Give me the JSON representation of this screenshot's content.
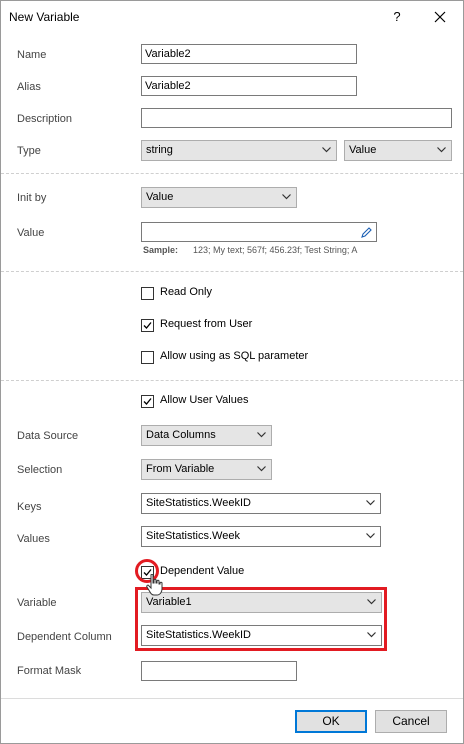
{
  "window": {
    "title": "New Variable",
    "help_label": "?"
  },
  "fields": {
    "name": {
      "label": "Name",
      "value": "Variable2"
    },
    "alias": {
      "label": "Alias",
      "value": "Variable2"
    },
    "description": {
      "label": "Description",
      "value": ""
    },
    "type": {
      "label": "Type",
      "value": "string",
      "kind": "Value"
    },
    "init_by": {
      "label": "Init by",
      "value": "Value"
    },
    "value": {
      "label": "Value",
      "value": "",
      "sample_label": "Sample:",
      "sample_text": "123; My text; 567f; 456.23f; Test String; A"
    }
  },
  "checkboxes": {
    "read_only": {
      "label": "Read Only",
      "checked": false
    },
    "request_from_user": {
      "label": "Request from User",
      "checked": true
    },
    "allow_sql": {
      "label": "Allow using as SQL parameter",
      "checked": false
    },
    "allow_user_values": {
      "label": "Allow User Values",
      "checked": true
    },
    "dependent_value": {
      "label": "Dependent Value",
      "checked": true
    }
  },
  "user_values": {
    "data_source": {
      "label": "Data Source",
      "value": "Data Columns"
    },
    "selection": {
      "label": "Selection",
      "value": "From Variable"
    },
    "keys": {
      "label": "Keys",
      "value": "SiteStatistics.WeekID"
    },
    "values": {
      "label": "Values",
      "value": "SiteStatistics.Week"
    },
    "variable": {
      "label": "Variable",
      "value": "Variable1"
    },
    "dependent_column": {
      "label": "Dependent Column",
      "value": "SiteStatistics.WeekID"
    },
    "format_mask": {
      "label": "Format Mask",
      "value": ""
    }
  },
  "buttons": {
    "ok": "OK",
    "cancel": "Cancel"
  },
  "colors": {
    "highlight": "#e21b22",
    "primary_border": "#0078d7"
  }
}
